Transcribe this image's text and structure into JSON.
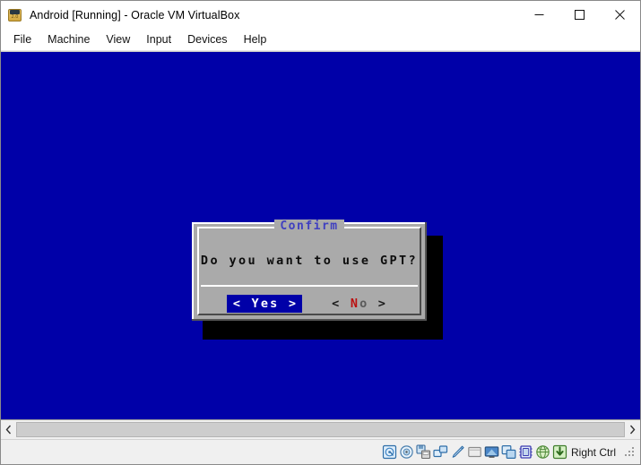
{
  "window": {
    "title": "Android [Running] - Oracle VM VirtualBox",
    "app_icon_name": "virtualbox-android-icon",
    "app_icon_badge": "2.0",
    "controls": {
      "minimize": "Minimize",
      "maximize": "Maximize",
      "close": "Close"
    }
  },
  "menubar": {
    "items": [
      {
        "label": "File"
      },
      {
        "label": "Machine"
      },
      {
        "label": "View"
      },
      {
        "label": "Input"
      },
      {
        "label": "Devices"
      },
      {
        "label": "Help"
      }
    ]
  },
  "vm_screen": {
    "background_color": "#0000a8",
    "dialog": {
      "title": "Confirm",
      "title_color": "#4040c0",
      "message": "Do you want to use GPT?",
      "background_color": "#aaaaaa",
      "buttons": [
        {
          "bracket_left": "<",
          "hotkey": "Y",
          "rest": "es",
          "bracket_right": ">",
          "label": "Yes",
          "selected": true,
          "highlight_color": "#0000a8"
        },
        {
          "bracket_left": "<",
          "hotkey": "N",
          "rest": "o",
          "bracket_right": ">",
          "label": "No",
          "selected": false,
          "hotkey_color": "#bb1111"
        }
      ]
    }
  },
  "scrollbar": {
    "left_arrow_icon": "chevron-left-icon",
    "right_arrow_icon": "chevron-right-icon"
  },
  "statusbar": {
    "icons": [
      {
        "name": "hard-disk-icon"
      },
      {
        "name": "optical-disk-icon"
      },
      {
        "name": "floppy-disk-icon"
      },
      {
        "name": "network-adapter-icon"
      },
      {
        "name": "usb-icon"
      },
      {
        "name": "shared-folders-icon"
      },
      {
        "name": "display-icon"
      },
      {
        "name": "remote-desktop-icon"
      },
      {
        "name": "cpu-icon"
      },
      {
        "name": "globe-icon"
      },
      {
        "name": "capture-icon"
      }
    ],
    "host_key": "Right Ctrl",
    "resize_grip_icon": "resize-grip-icon"
  }
}
